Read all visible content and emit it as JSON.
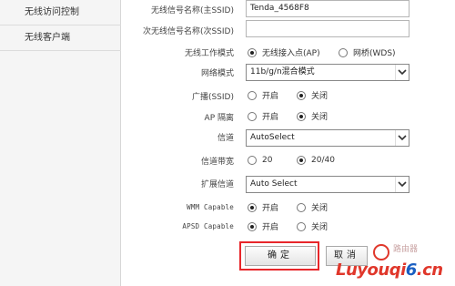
{
  "sidebar": {
    "items": [
      {
        "label": "无线访问控制"
      },
      {
        "label": "无线客户端"
      }
    ]
  },
  "form": {
    "ssid_primary": {
      "label": "无线信号名称(主SSID)",
      "value": "Tenda_4568F8"
    },
    "ssid_secondary": {
      "label": "次无线信号名称(次SSID)",
      "value": ""
    },
    "work_mode": {
      "label": "无线工作模式",
      "options": [
        "无线接入点(AP)",
        "网桥(WDS)"
      ],
      "selected": "无线接入点(AP)"
    },
    "network_mode": {
      "label": "网络模式",
      "value": "11b/g/n混合模式"
    },
    "broadcast": {
      "label": "广播(SSID)",
      "options": [
        "开启",
        "关闭"
      ],
      "selected": "关闭"
    },
    "ap_isolation": {
      "label": "AP 隔离",
      "options": [
        "开启",
        "关闭"
      ],
      "selected": "关闭"
    },
    "channel": {
      "label": "信道",
      "value": "AutoSelect"
    },
    "bandwidth": {
      "label": "信道带宽",
      "options": [
        "20",
        "20/40"
      ],
      "selected": "20/40"
    },
    "ext_channel": {
      "label": "扩展信道",
      "value": "Auto Select"
    },
    "wmm": {
      "label": "WMM Capable",
      "options": [
        "开启",
        "关闭"
      ],
      "selected": "开启"
    },
    "apsd": {
      "label": "APSD Capable",
      "options": [
        "开启",
        "关闭"
      ],
      "selected": "开启"
    }
  },
  "buttons": {
    "ok": "确定",
    "cancel": "取消"
  },
  "watermark": {
    "text_part1": "Luyouqi",
    "text_part2": "6",
    "text_part3": ".cn",
    "sub": "路由器"
  },
  "colors": {
    "highlight": "#e8262a",
    "watermark_red": "#e0372b",
    "watermark_blue": "#1a5fc2"
  }
}
